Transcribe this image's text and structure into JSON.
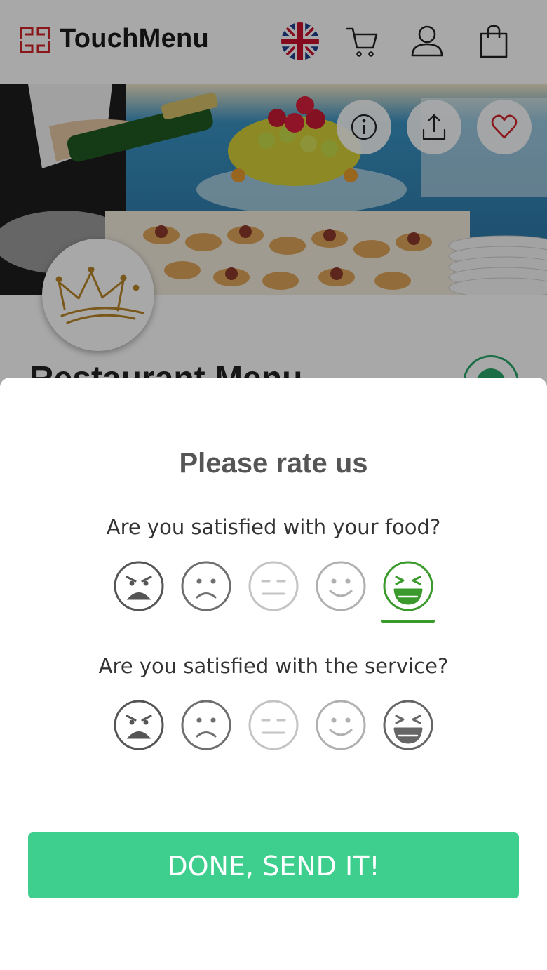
{
  "header": {
    "brand": "TouchMenu",
    "icons": {
      "language": "uk-flag-icon",
      "cart": "cart-icon",
      "account": "user-icon",
      "bag": "bag-icon"
    }
  },
  "hero": {
    "actions": [
      "info-icon",
      "share-icon",
      "heart-icon"
    ]
  },
  "restaurant": {
    "title": "Restaurant Menu"
  },
  "rating_modal": {
    "title": "Please rate us",
    "questions": [
      {
        "text": "Are you satisfied with your food?",
        "options": [
          "very-dissatisfied",
          "dissatisfied",
          "neutral",
          "satisfied",
          "very-satisfied"
        ],
        "selected": "very-satisfied"
      },
      {
        "text": "Are you satisfied with the service?",
        "options": [
          "very-dissatisfied",
          "dissatisfied",
          "neutral",
          "satisfied",
          "very-satisfied"
        ],
        "selected": null
      }
    ],
    "submit_label": "DONE, SEND IT!"
  },
  "colors": {
    "accent_green": "#3ecf8e",
    "selected_face": "#3a9b2c",
    "logo_red": "#d2232a",
    "crown_gold": "#b9862a"
  }
}
